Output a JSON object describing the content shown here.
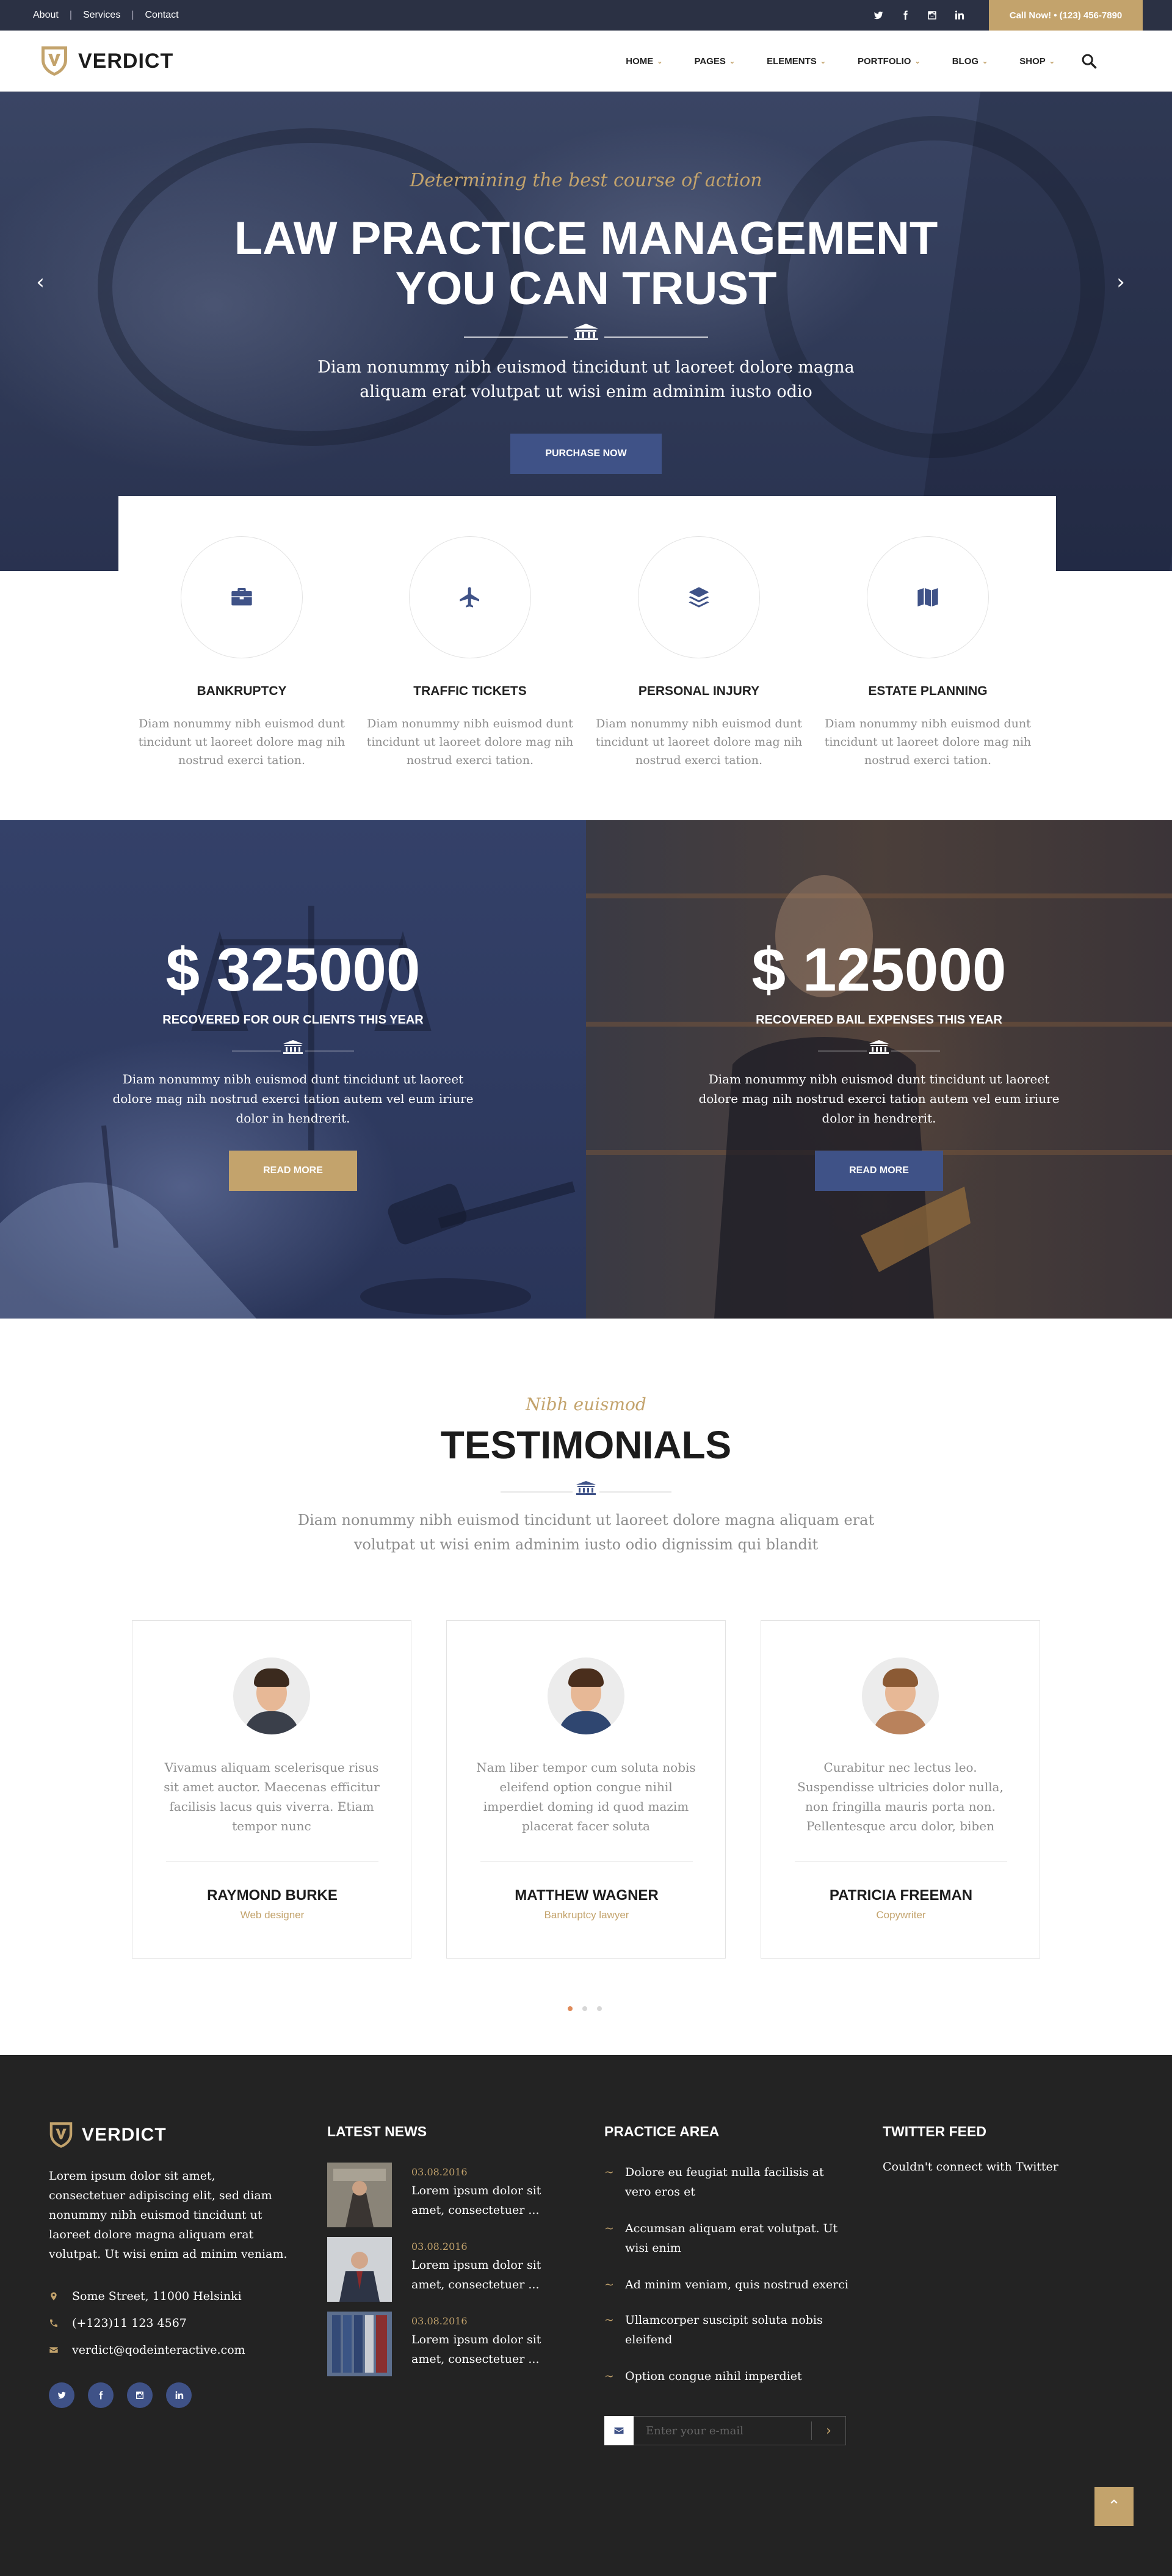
{
  "topbar": {
    "links": [
      "About",
      "Services",
      "Contact"
    ],
    "social_icons": [
      "twitter-icon",
      "facebook-icon",
      "instagram-icon",
      "linkedin-icon"
    ],
    "cta": "Call Now! • (123) 456-7890"
  },
  "header": {
    "logo_text": "VERDICT",
    "nav": [
      "HOME",
      "PAGES",
      "ELEMENTS",
      "PORTFOLIO",
      "BLOG",
      "SHOP"
    ],
    "search_icon": "search-icon"
  },
  "hero": {
    "subtitle": "Determining the best course of action",
    "title_line1": "LAW PRACTICE MANAGEMENT",
    "title_line2": "YOU CAN TRUST",
    "text_line1": "Diam nonummy nibh euismod tincidunt ut laoreet dolore magna",
    "text_line2": "aliquam erat volutpat ut wisi enim adminim iusto odio",
    "button": "PURCHASE NOW",
    "prev_arrow": "‹",
    "next_arrow": "›"
  },
  "practice": [
    {
      "icon": "briefcase-icon",
      "title": "BANKRUPTCY",
      "text": "Diam nonummy nibh euismod dunt tincidunt ut laoreet dolore mag nih nostrud exerci tation."
    },
    {
      "icon": "plane-icon",
      "title": "TRAFFIC TICKETS",
      "text": "Diam nonummy nibh euismod dunt tincidunt ut laoreet dolore mag nih nostrud exerci tation."
    },
    {
      "icon": "layers-icon",
      "title": "PERSONAL INJURY",
      "text": "Diam nonummy nibh euismod dunt tincidunt ut laoreet dolore mag nih nostrud exerci tation."
    },
    {
      "icon": "map-icon",
      "title": "ESTATE PLANNING",
      "text": "Diam nonummy nibh euismod dunt tincidunt ut laoreet dolore mag nih nostrud exerci tation."
    }
  ],
  "stats": [
    {
      "amount": "$ 325000",
      "label": "RECOVERED FOR OUR CLIENTS THIS YEAR",
      "text": "Diam nonummy nibh euismod dunt tincidunt ut laoreet dolore mag nih nostrud exerci tation autem vel eum iriure dolor in hendrerit.",
      "button": "READ MORE",
      "button_color": "#c3a36c"
    },
    {
      "amount": "$ 125000",
      "label": "RECOVERED BAIL EXPENSES THIS YEAR",
      "text": "Diam nonummy nibh euismod dunt tincidunt ut laoreet dolore mag nih nostrud exerci tation autem vel eum iriure dolor in hendrerit.",
      "button": "READ MORE",
      "button_color": "#3f5287"
    }
  ],
  "testimonials": {
    "subtitle": "Nibh euismod",
    "title": "TESTIMONIALS",
    "text": "Diam nonummy nibh euismod tincidunt ut laoreet dolore magna aliquam erat volutpat ut wisi enim adminim iusto odio dignissim qui blandit",
    "items": [
      {
        "quote": "Vivamus aliquam scelerisque risus sit amet auctor. Maecenas efficitur facilisis lacus quis viverra. Etiam tempor nunc",
        "name": "RAYMOND BURKE",
        "role": "Web designer"
      },
      {
        "quote": "Nam liber tempor cum soluta nobis eleifend option congue nihil imperdiet doming id quod mazim placerat facer soluta",
        "name": "MATTHEW WAGNER",
        "role": "Bankruptcy lawyer"
      },
      {
        "quote": "Curabitur nec lectus leo. Suspendisse ultricies dolor nulla, non fringilla mauris porta non. Pellentesque arcu dolor, biben",
        "name": "PATRICIA FREEMAN",
        "role": "Copywriter"
      }
    ],
    "active_dot": 1,
    "dot_count": 3
  },
  "footer": {
    "logo_text": "VERDICT",
    "about": "Lorem ipsum dolor sit amet, consectetuer adipiscing elit, sed diam nonummy nibh euismod tincidunt ut laoreet dolore magna aliquam erat volutpat. Ut wisi enim ad minim veniam.",
    "address": "Some Street, 11000 Helsinki",
    "phone": "(+123)11 123 4567",
    "email": "verdict@qodeinteractive.com",
    "latest_news_title": "LATEST NEWS",
    "news": [
      {
        "date": "03.08.2016",
        "title": "Lorem ipsum dolor sit amet, consectetuer ..."
      },
      {
        "date": "03.08.2016",
        "title": "Lorem ipsum dolor sit amet, consectetuer ..."
      },
      {
        "date": "03.08.2016",
        "title": "Lorem ipsum dolor sit amet, consectetuer ..."
      }
    ],
    "practice_area_title": "PRACTICE AREA",
    "practice_area": [
      "Dolore eu feugiat nulla facilisis at vero eros et",
      "Accumsan aliquam erat volutpat. Ut wisi enim",
      "Ad minim veniam, quis nostrud exerci",
      "Ullamcorper suscipit soluta nobis eleifend",
      "Option congue nihil imperdiet"
    ],
    "newsletter_placeholder": "Enter your e-mail",
    "twitter_title": "TWITTER FEED",
    "twitter_text": "Couldn't connect with Twitter",
    "back_to_top": "⌃"
  },
  "colors": {
    "accent": "#c3a36c",
    "navy": "#3f5287",
    "topbar": "#2b3144",
    "footer": "#232323"
  }
}
